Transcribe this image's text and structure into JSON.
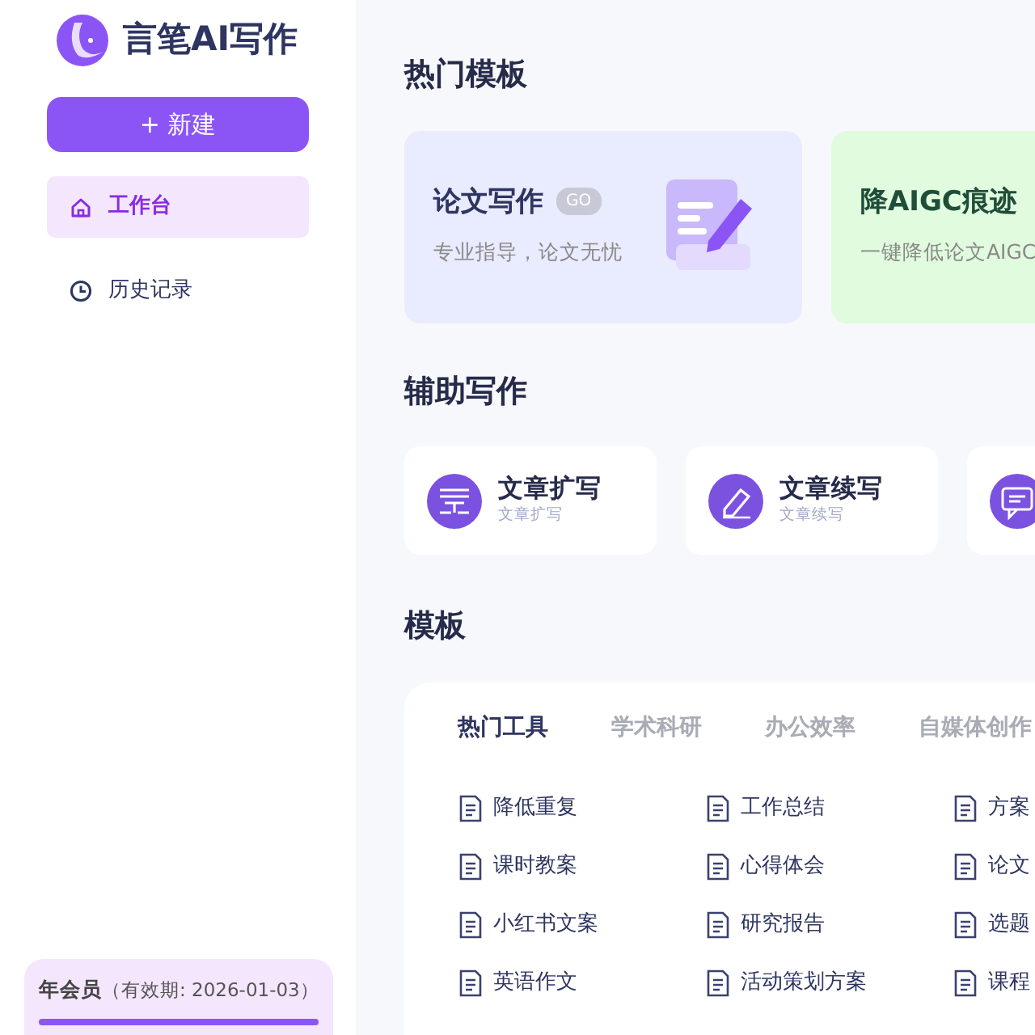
{
  "sidebar": {
    "logo_text": "言笔AI写作",
    "new_button": {
      "icon": "+",
      "label": "新建"
    },
    "items": [
      {
        "label": "工作台",
        "kind": "home",
        "selected": true
      },
      {
        "label": "历史记录",
        "kind": "clock",
        "selected": false
      }
    ],
    "membership": {
      "title": "年会员",
      "validity": "（有效期: 2026-01-03）",
      "level": 1
    }
  },
  "sections": {
    "hot_title": "热门模板",
    "assist_title": "辅助写作",
    "template_title": "模板"
  },
  "hot_cards": [
    {
      "title": "论文写作",
      "badge": "GO",
      "subtitle": "专业指导，论文无忧",
      "color": "#e9ebfe"
    },
    {
      "title": "降AIGC痕迹",
      "subtitle": "一键降低论文AIGC",
      "color": "#e0fbdd"
    }
  ],
  "assist_cards": [
    {
      "title": "文章扩写",
      "subtitle": "文章扩写",
      "kind": "lines"
    },
    {
      "title": "文章续写",
      "subtitle": "文章续写",
      "kind": "pencil"
    },
    {
      "kind": "chat"
    }
  ],
  "template_tabs": [
    {
      "label": "热门工具",
      "selected": true
    },
    {
      "label": "学术科研",
      "selected": false
    },
    {
      "label": "办公效率",
      "selected": false
    },
    {
      "label": "自媒体创作",
      "selected": false
    }
  ],
  "template_items": [
    {
      "label": "降低重复"
    },
    {
      "label": "工作总结"
    },
    {
      "label": "方案"
    },
    {
      "label": "课时教案"
    },
    {
      "label": "心得体会"
    },
    {
      "label": "论文"
    },
    {
      "label": "小红书文案"
    },
    {
      "label": "研究报告"
    },
    {
      "label": "选题"
    },
    {
      "label": "英语作文"
    },
    {
      "label": "活动策划方案"
    },
    {
      "label": "课程"
    }
  ]
}
